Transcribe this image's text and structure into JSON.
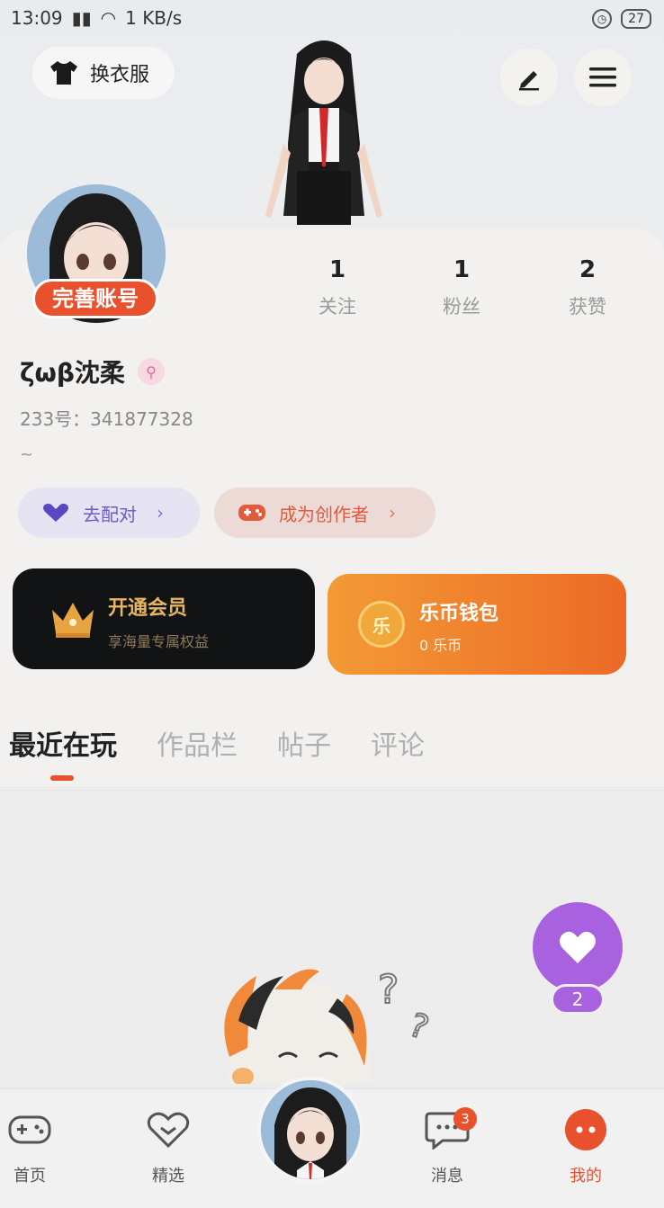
{
  "status_bar": {
    "time": "13:09",
    "network_speed": "1 KB/s",
    "battery": "27"
  },
  "header": {
    "outfit_label": "换衣服",
    "edit_icon": "pencil-icon",
    "menu_icon": "hamburger-menu-icon"
  },
  "profile": {
    "complete_account_label": "完善账号",
    "username": "ζωβ沈柔",
    "uid": "233号：341877328",
    "bio": "~",
    "stats": [
      {
        "value": "1",
        "label": "关注"
      },
      {
        "value": "1",
        "label": "粉丝"
      },
      {
        "value": "2",
        "label": "获赞"
      }
    ]
  },
  "actions": {
    "pair_label": "去配对",
    "creator_label": "成为创作者",
    "chevron": "›"
  },
  "vip": {
    "title": "开通会员",
    "subtitle": "享海量专属权益"
  },
  "wallet": {
    "coin_glyph": "乐",
    "title": "乐币钱包",
    "subtitle": "0 乐币"
  },
  "tabs": [
    {
      "label": "最近在玩",
      "active": true
    },
    {
      "label": "作品栏",
      "active": false
    },
    {
      "label": "帖子",
      "active": false
    },
    {
      "label": "评论",
      "active": false
    }
  ],
  "like_fab": {
    "count": "2"
  },
  "bottom_nav": [
    {
      "label": "首页",
      "icon": "gamepad-icon"
    },
    {
      "label": "精选",
      "icon": "heart-badge-icon"
    },
    {
      "label": "消息",
      "icon": "chat-bubble-icon",
      "badge": "3"
    },
    {
      "label": "我的",
      "icon": "profile-face-icon",
      "active": true
    }
  ],
  "colors": {
    "accent": "#e9502c",
    "purple": "#a962df",
    "gold": "#e7b562",
    "wallet_orange": "#ec6a26"
  }
}
